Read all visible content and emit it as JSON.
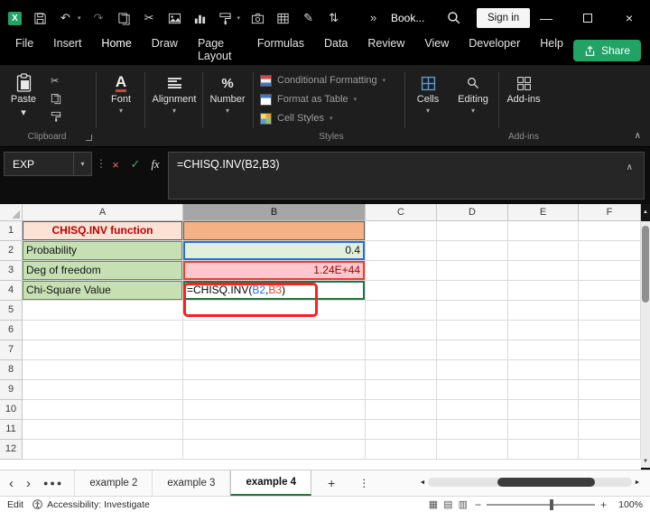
{
  "window": {
    "title": "Book...",
    "sign_in_label": "Sign in"
  },
  "quick_access": {
    "icons": [
      "excel-icon",
      "save-icon",
      "undo-icon",
      "redo-icon",
      "copies-icon",
      "cut-icon",
      "picture-icon",
      "chart-icon",
      "paint-icon",
      "camera-icon",
      "table-icon",
      "pen-icon",
      "sort-icon",
      "overflow-icon"
    ]
  },
  "menubar": {
    "items": [
      "File",
      "Insert",
      "Home",
      "Draw",
      "Page Layout",
      "Formulas",
      "Data",
      "Review",
      "View",
      "Developer",
      "Help"
    ],
    "active_item": "Home",
    "share_label": "Share"
  },
  "ribbon": {
    "paste": "Paste",
    "clipboard_group": "Clipboard",
    "font": "Font",
    "alignment": "Alignment",
    "number": "Number",
    "styles_items": [
      "Conditional Formatting",
      "Format as Table",
      "Cell Styles"
    ],
    "styles_group": "Styles",
    "cells": "Cells",
    "editing": "Editing",
    "addins": "Add-ins",
    "addins_group": "Add-ins"
  },
  "formula_bar": {
    "name_box_value": "EXP",
    "formula": "=CHISQ.INV(B2,B3)"
  },
  "grid": {
    "columns": [
      "A",
      "B",
      "C",
      "D",
      "E",
      "F"
    ],
    "rows": [
      "1",
      "2",
      "3",
      "4",
      "5",
      "6",
      "7",
      "8",
      "9",
      "10",
      "11",
      "12"
    ],
    "highlight_column": "B",
    "cells": {
      "A1": "CHISQ.INV function",
      "A2": "Probability",
      "A3": "Deg of freedom",
      "A4": "Chi-Square Value",
      "B2": "0.4",
      "B3": "1.24E+44"
    },
    "cell_styles": {
      "A1": "c-title",
      "B1": "c-orange",
      "A2": "c-glabel",
      "A3": "c-glabel",
      "A4": "c-glabel",
      "B2": "c-gval c-num c-refblue",
      "B3": "c-num c-refred",
      "B4": "c-edit"
    },
    "formula_cell": {
      "ref": "B4",
      "parts": [
        {
          "text": "=CHISQ.INV(",
          "color": "formula_default"
        },
        {
          "text": "B2",
          "color": "ref_blue"
        },
        {
          "text": ",",
          "color": "formula_default"
        },
        {
          "text": "B3",
          "color": "ref_red"
        },
        {
          "text": ")",
          "color": "formula_default"
        }
      ]
    }
  },
  "sheet_tabs": {
    "tabs": [
      "example 2",
      "example 3",
      "example 4"
    ],
    "active_tab": "example 4"
  },
  "status_bar": {
    "mode": "Edit",
    "accessibility": "Accessibility: Investigate",
    "zoom_level": "100%"
  },
  "colors": {
    "accent_green": "#21A366",
    "title_red": "#C00000",
    "fill_peach": "#FBE2D5",
    "fill_orange": "#F4B183",
    "fill_green": "#C6E0B4",
    "fill_light_green": "#E2EFDA",
    "fill_pink": "#FFC7CE",
    "bad_text": "#9C0006",
    "ref_blue": "#2B6BE0",
    "ref_red": "#E8402A",
    "formula_default": "#000000",
    "annotation_red": "#FF1D1D"
  }
}
